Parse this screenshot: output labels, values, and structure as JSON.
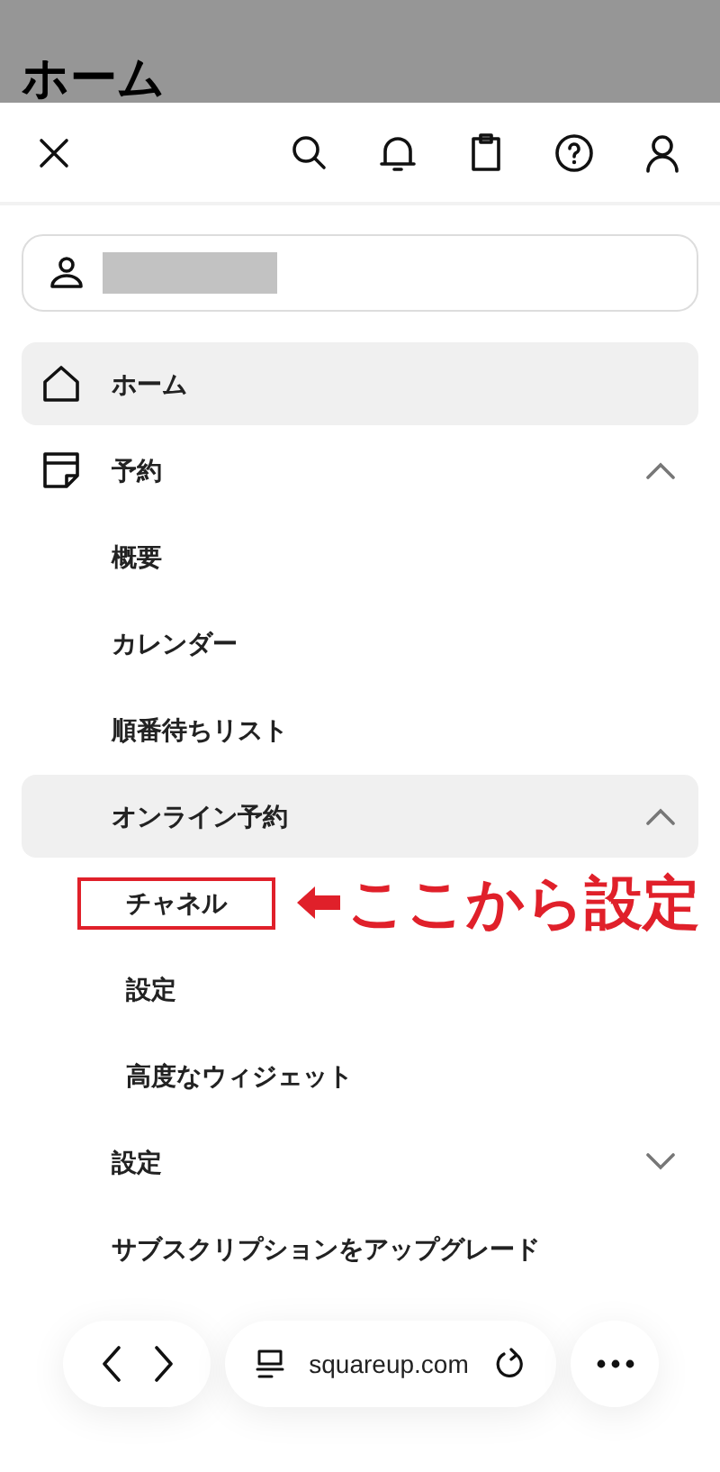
{
  "page_title": "ホーム",
  "nav": [
    {
      "label": "ホーム",
      "kind": "home",
      "selected": true
    },
    {
      "label": "予約",
      "kind": "calendar",
      "selected": false,
      "expanded": true,
      "children": [
        {
          "label": "概要",
          "selected": false
        },
        {
          "label": "カレンダー",
          "selected": false
        },
        {
          "label": "順番待ちリスト",
          "selected": false
        },
        {
          "label": "オンライン予約",
          "selected": true,
          "expanded": true,
          "children": [
            {
              "label": "チャネル",
              "selected": false,
              "highlighted": true
            },
            {
              "label": "設定",
              "selected": false
            },
            {
              "label": "高度なウィジェット",
              "selected": false
            }
          ]
        },
        {
          "label": "設定",
          "selected": false,
          "expanded": false
        },
        {
          "label": "サブスクリプションをアップグレード",
          "selected": false
        }
      ]
    }
  ],
  "annotation": {
    "text": "ここから設定"
  },
  "browser_bar": {
    "url": "squareup.com"
  }
}
